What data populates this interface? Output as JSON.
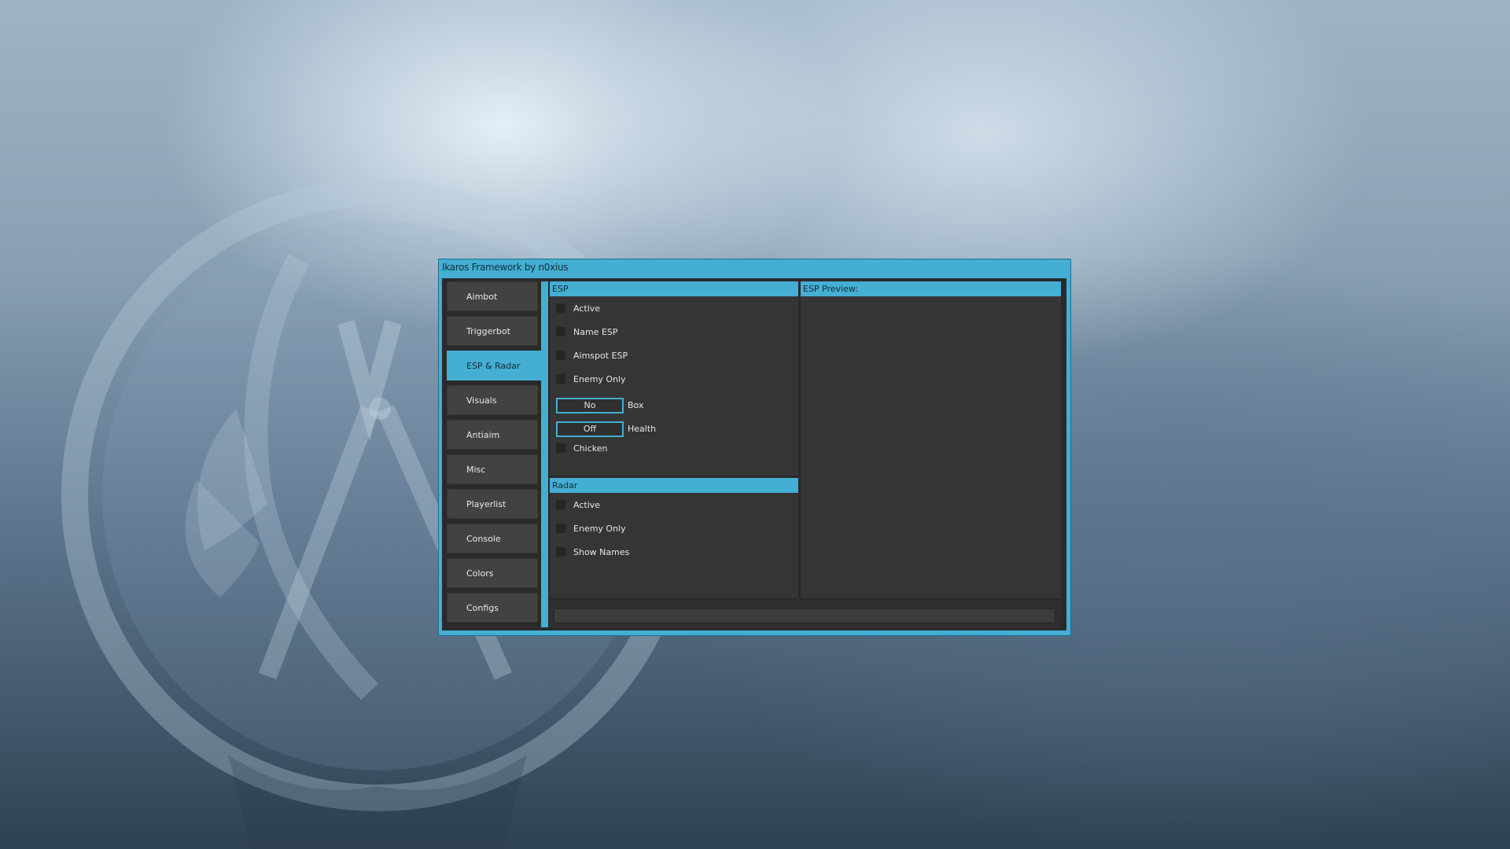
{
  "window": {
    "title": "Ikaros Framework by n0xius"
  },
  "sidebar": {
    "items": [
      {
        "label": "Aimbot"
      },
      {
        "label": "Triggerbot"
      },
      {
        "label": "ESP & Radar"
      },
      {
        "label": "Visuals"
      },
      {
        "label": "Antiaim"
      },
      {
        "label": "Misc"
      },
      {
        "label": "Playerlist"
      },
      {
        "label": "Console"
      },
      {
        "label": "Colors"
      },
      {
        "label": "Configs"
      }
    ],
    "active": "ESP & Radar"
  },
  "esp": {
    "header": "ESP",
    "active_label": "Active",
    "name_esp_label": "Name ESP",
    "aimspot_esp_label": "Aimspot ESP",
    "enemy_only_label": "Enemy Only",
    "box_value": "No",
    "box_label": "Box",
    "health_value": "Off",
    "health_label": "Health",
    "chicken_label": "Chicken"
  },
  "radar": {
    "header": "Radar",
    "active_label": "Active",
    "enemy_only_label": "Enemy Only",
    "show_names_label": "Show Names"
  },
  "preview": {
    "header": "ESP Preview:"
  },
  "colors": {
    "accent": "#44aed3",
    "panel": "#353535",
    "background": "#2a2a2a"
  }
}
